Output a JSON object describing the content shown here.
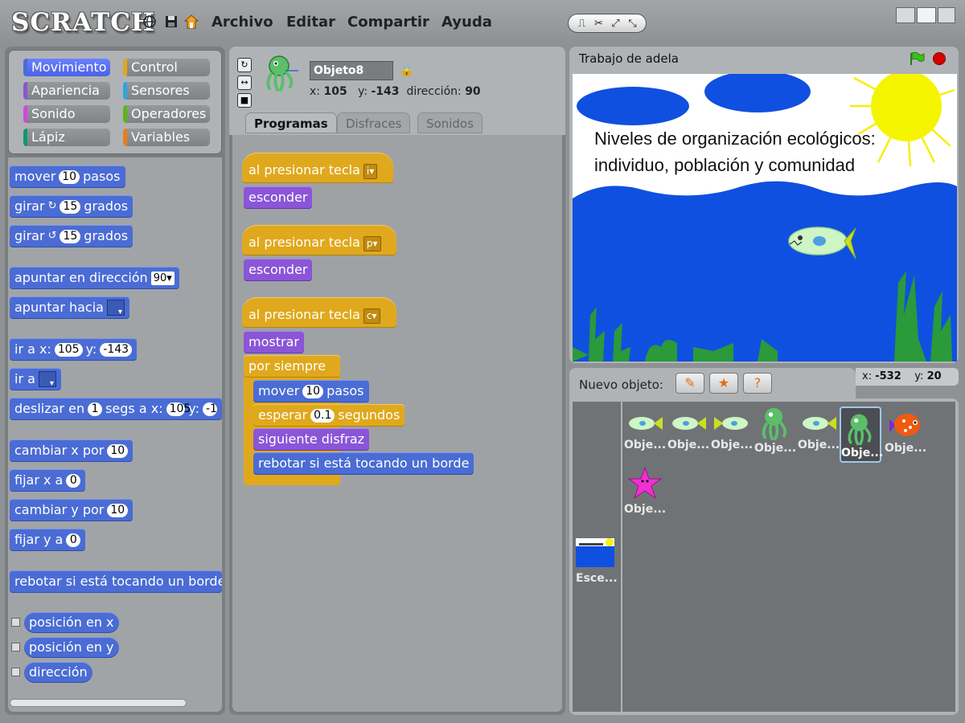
{
  "app": {
    "logo": "SCRATCH"
  },
  "menu": {
    "file": "Archivo",
    "edit": "Editar",
    "share": "Compartir",
    "help": "Ayuda"
  },
  "categories": {
    "motion": "Movimiento",
    "control": "Control",
    "looks": "Apariencia",
    "sensing": "Sensores",
    "sound": "Sonido",
    "operators": "Operadores",
    "pen": "Lápiz",
    "variables": "Variables"
  },
  "palette": {
    "move": "mover",
    "move_val": "10",
    "steps": "pasos",
    "turn": "girar",
    "turn_r_val": "15",
    "degrees": "grados",
    "turn_l_val": "15",
    "point_dir": "apuntar en dirección",
    "point_dir_val": "90",
    "point_towards": "apuntar hacia",
    "goto_xy": "ir a x:",
    "goto_x_val": "105",
    "y_label": "y:",
    "goto_y_val": "-143",
    "goto": "ir a",
    "glide": "deslizar en",
    "glide_secs": "1",
    "glide_text": "segs a x:",
    "glide_x": "105",
    "glide_y": "-1",
    "change_x": "cambiar x por",
    "change_x_val": "10",
    "set_x": "fijar x a",
    "set_x_val": "0",
    "change_y": "cambiar y por",
    "change_y_val": "10",
    "set_y": "fijar y a",
    "set_y_val": "0",
    "bounce": "rebotar si está tocando un borde",
    "x_position": "posición en x",
    "y_position": "posición en y",
    "direction": "dirección"
  },
  "sprite": {
    "name": "Objeto8",
    "x_label": "x:",
    "x": "105",
    "y_label": "y:",
    "y": "-143",
    "dir_label": "dirección:",
    "dir": "90"
  },
  "tabs": {
    "scripts": "Programas",
    "costumes": "Disfraces",
    "sounds": "Sonidos"
  },
  "scripts": {
    "hat_label": "al presionar tecla",
    "key1": "i",
    "key2": "p",
    "key3": "c",
    "hide": "esconder",
    "show": "mostrar",
    "forever": "por siempre",
    "move": "mover",
    "move_val": "10",
    "steps": "pasos",
    "wait": "esperar",
    "wait_val": "0.1",
    "seconds": "segundos",
    "next_costume": "siguiente disfraz",
    "bounce": "rebotar si está tocando un borde"
  },
  "stage": {
    "title": "Trabajo de adela",
    "text": "Niveles de organización ecológicos: individuo, población y comunidad"
  },
  "sprite_list": {
    "new_label": "Nuevo objeto:",
    "mouse_x_label": "x:",
    "mouse_x": "-532",
    "mouse_y_label": "y:",
    "mouse_y": "20",
    "stage_label": "Esce...",
    "items": [
      "Obje...",
      "Obje...",
      "Obje...",
      "Obje...",
      "Obje...",
      "Obje...",
      "Obje...",
      "Obje..."
    ]
  },
  "colors": {
    "motion": "#4a6cd4",
    "looks": "#8a55d7",
    "sound": "#cf4ad9",
    "pen": "#0e9a6c",
    "control": "#e0a81c",
    "sensing": "#2ca5e2",
    "operators": "#5cb712",
    "variables": "#ee7d16"
  }
}
